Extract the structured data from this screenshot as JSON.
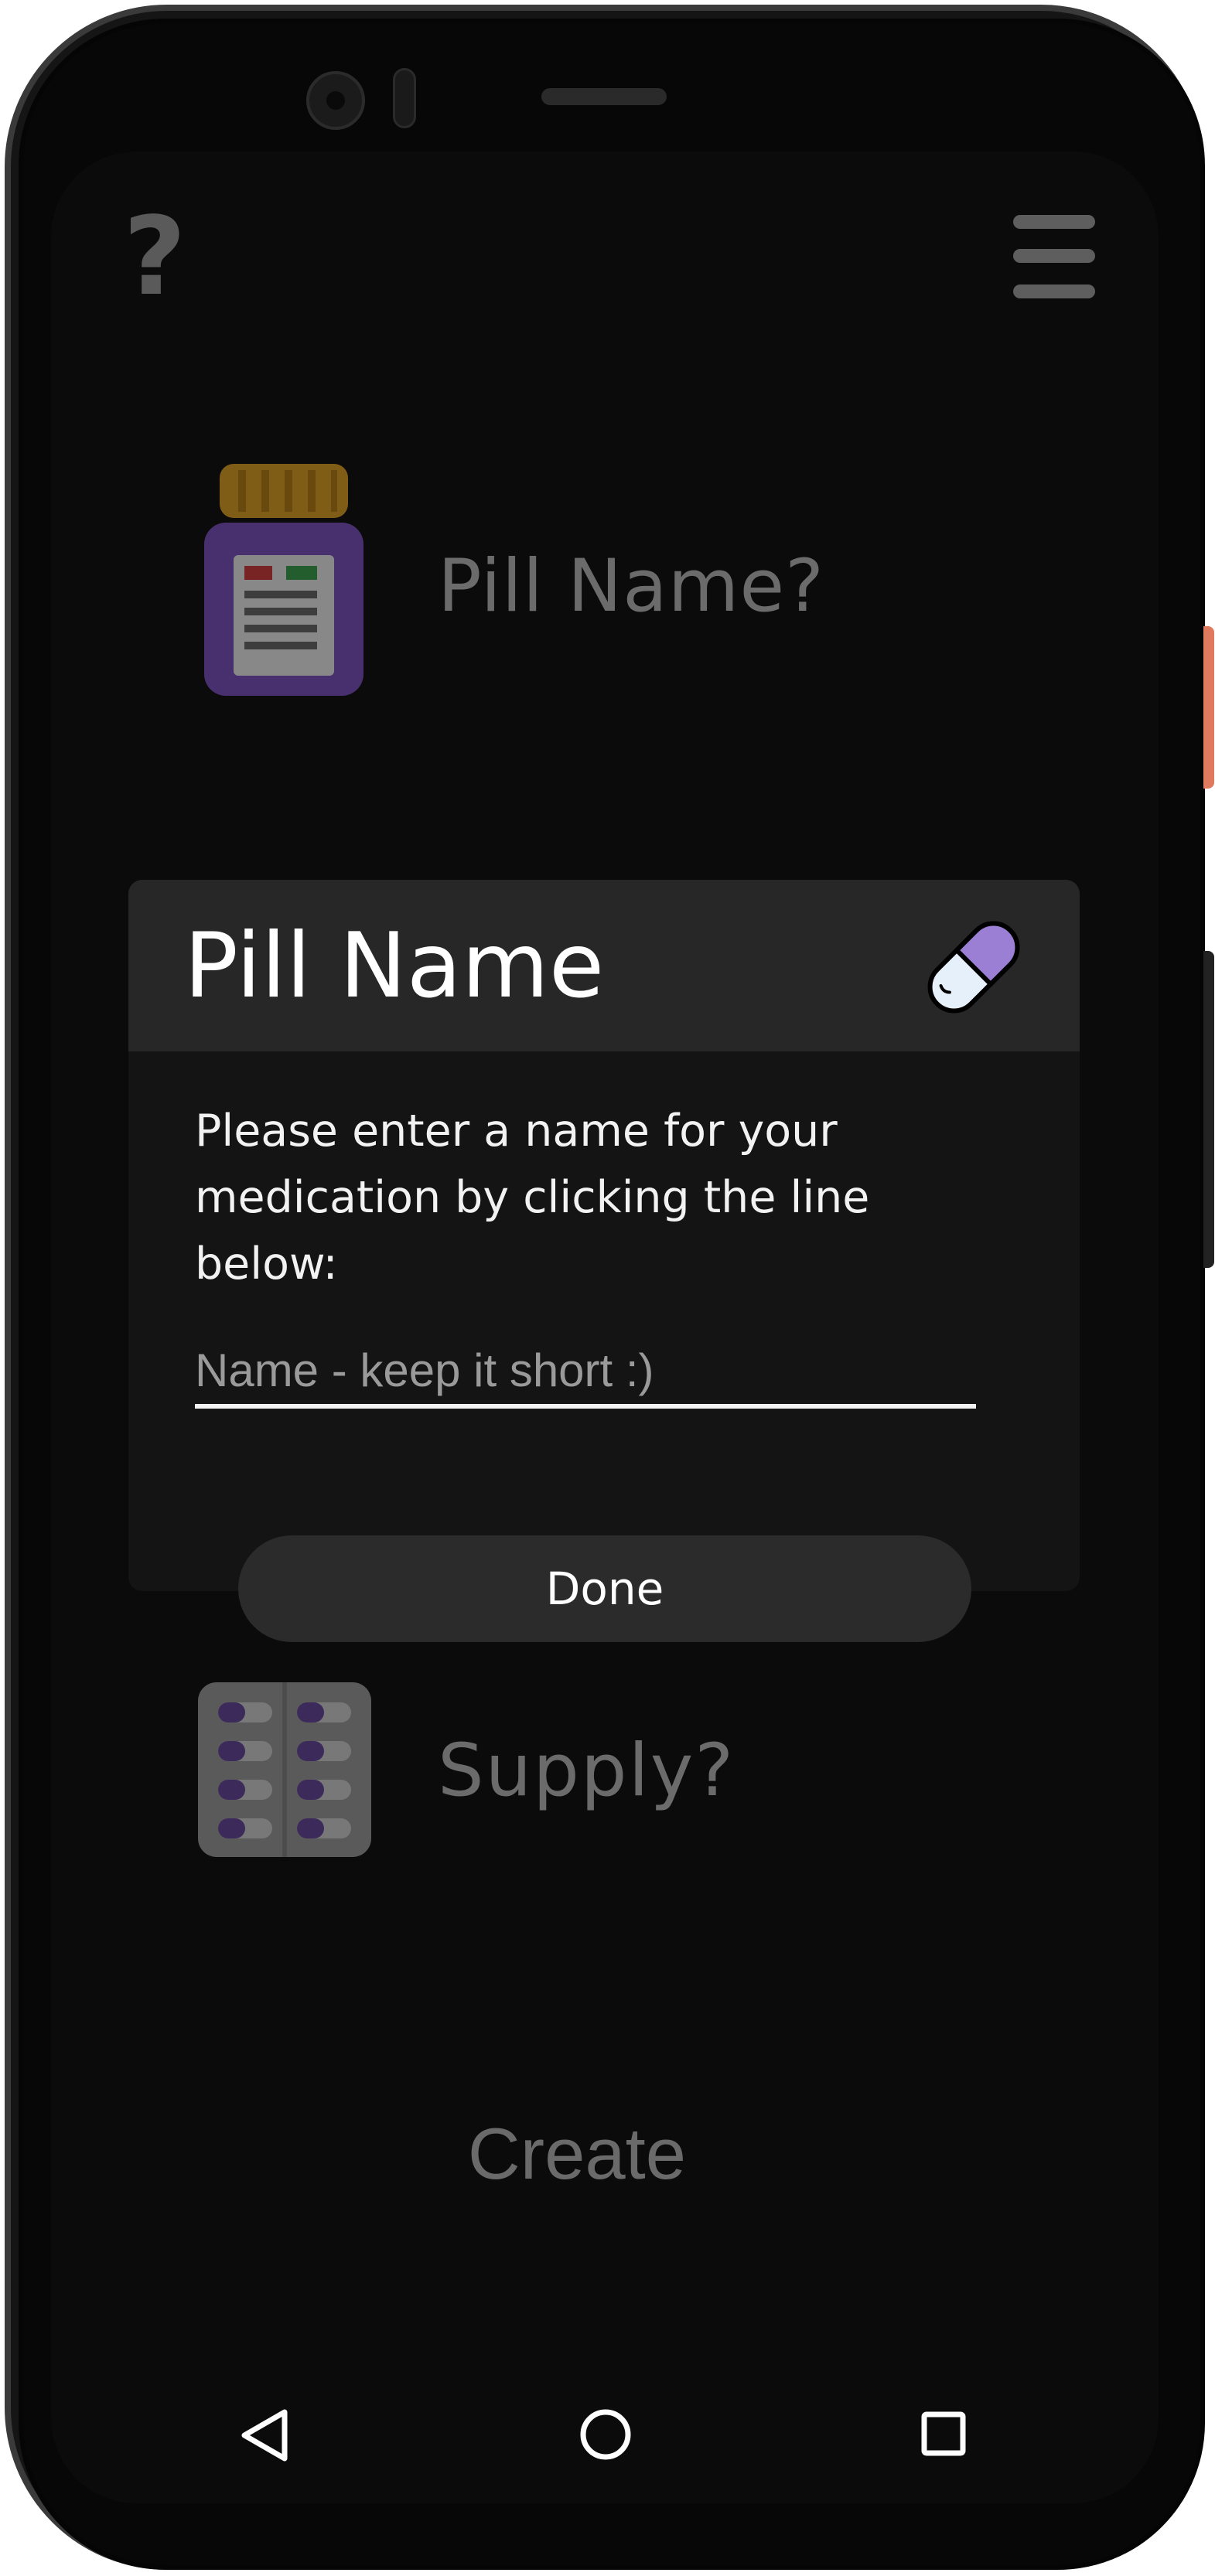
{
  "screen": {
    "help_icon_glyph": "?",
    "pill_name_prompt": "Pill Name?",
    "supply_prompt": "Supply?",
    "create_label": "Create"
  },
  "dialog": {
    "title": "Pill Name",
    "message": "Please enter a name for your medication by clicking the line below:",
    "name_input": {
      "value": "",
      "placeholder": "Name - keep it short :)"
    },
    "done_label": "Done"
  },
  "icons": {
    "help": "question-mark-icon",
    "menu": "hamburger-menu-icon",
    "bottle": "pill-bottle-icon",
    "capsule": "capsule-icon",
    "blister": "blister-pack-icon",
    "nav_back": "back-triangle-icon",
    "nav_home": "home-circle-icon",
    "nav_recents": "recents-square-icon"
  },
  "colors": {
    "capsule_purple": "#9b7fd4",
    "bottle_purple": "#7a4fc0",
    "bottle_cap": "#e0a020",
    "dialog_header": "#272727",
    "dialog_body": "#141414"
  }
}
